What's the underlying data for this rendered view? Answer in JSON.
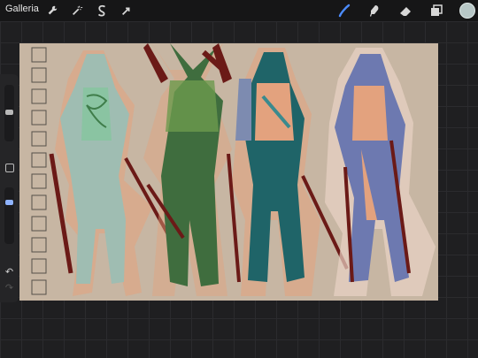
{
  "topbar": {
    "gallery_label": "Galleria",
    "left_tools": [
      "wrench-icon",
      "magic-wand-icon",
      "selection-s-icon",
      "transform-arrow-icon"
    ],
    "right_tools": [
      "brush-icon",
      "smudge-icon",
      "eraser-icon",
      "layers-icon"
    ],
    "active_tool": "brush-icon",
    "accent_color": "#4c8cff",
    "current_color": "#b7c7c6"
  },
  "sidebar": {
    "controls": [
      "brush-size-slider",
      "modify-square-button",
      "opacity-slider",
      "undo-arrow-icon",
      "redo-arrow-icon"
    ]
  },
  "canvas": {
    "background_color": "#c7b6a3",
    "figure_colors": [
      "#9fbdb2",
      "#3f6d3e",
      "#1f6468",
      "#6d79b0"
    ],
    "accent_red": "#6b1a17",
    "skin_tone": "#e3a27e"
  }
}
